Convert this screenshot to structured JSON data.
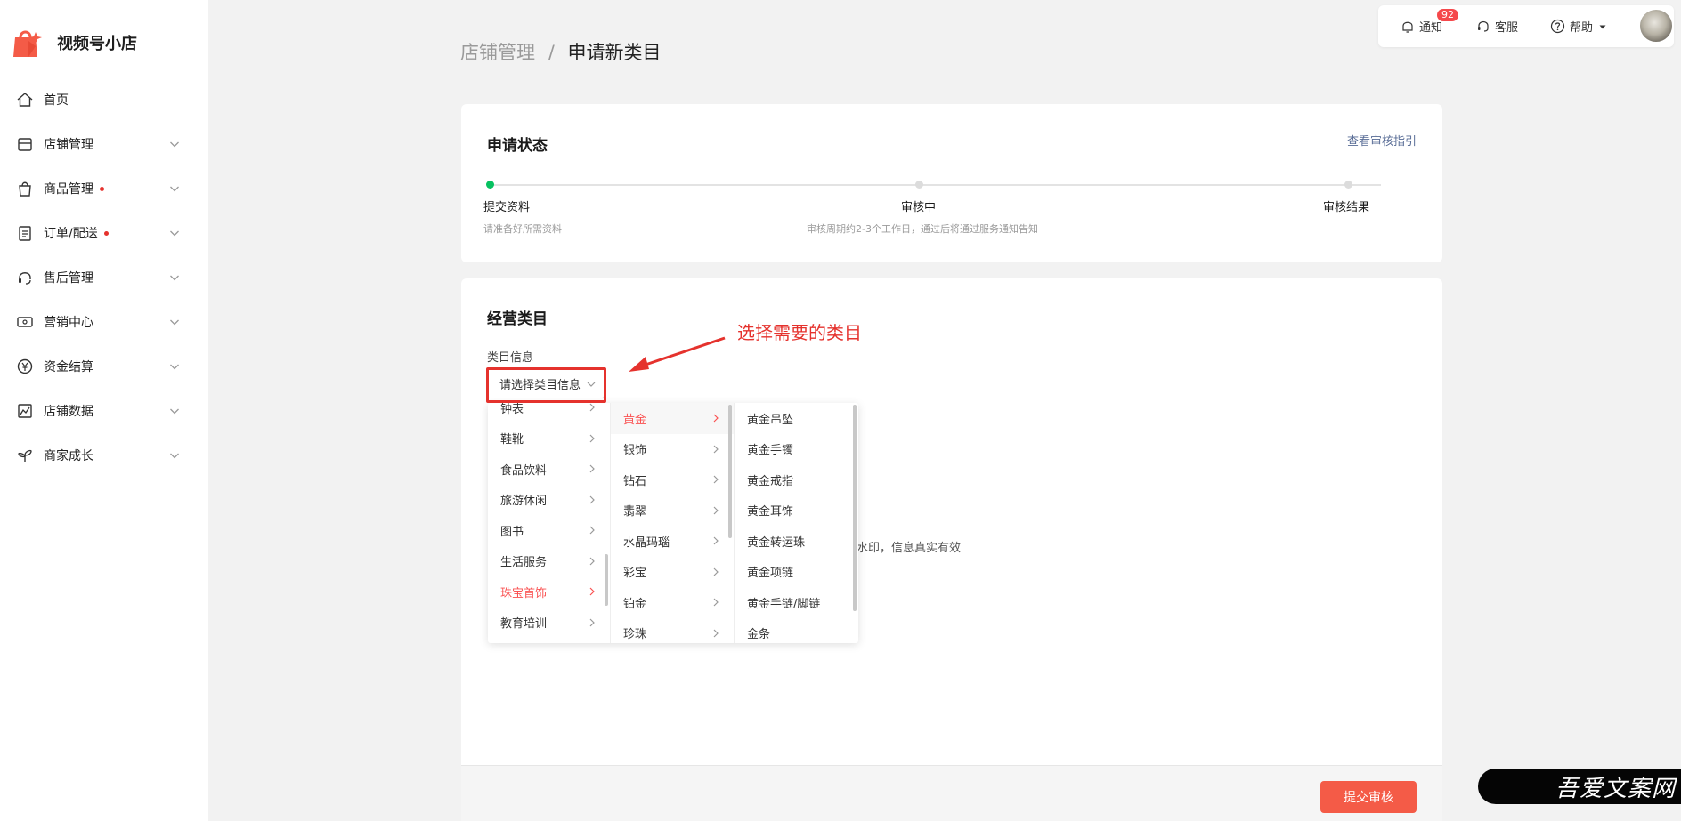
{
  "brand": {
    "name": "视频号小店"
  },
  "nav": [
    {
      "label": "首页",
      "icon": "home-icon",
      "dot": false,
      "chevron": false
    },
    {
      "label": "店铺管理",
      "icon": "store-icon",
      "dot": false,
      "chevron": true
    },
    {
      "label": "商品管理",
      "icon": "bag-icon",
      "dot": true,
      "chevron": true
    },
    {
      "label": "订单/配送",
      "icon": "clipboard-icon",
      "dot": true,
      "chevron": true
    },
    {
      "label": "售后管理",
      "icon": "headset-icon",
      "dot": false,
      "chevron": true
    },
    {
      "label": "营销中心",
      "icon": "ticket-icon",
      "dot": false,
      "chevron": true
    },
    {
      "label": "资金结算",
      "icon": "yen-icon",
      "dot": false,
      "chevron": true
    },
    {
      "label": "店铺数据",
      "icon": "chart-icon",
      "dot": false,
      "chevron": true
    },
    {
      "label": "商家成长",
      "icon": "sprout-icon",
      "dot": false,
      "chevron": true
    }
  ],
  "topbar": {
    "notify_label": "通知",
    "notify_count": "92",
    "service_label": "客服",
    "help_label": "帮助"
  },
  "breadcrumb": {
    "parent": "店铺管理",
    "separator": "/",
    "current": "申请新类目"
  },
  "status_card": {
    "title": "申请状态",
    "guide_link": "查看审核指引",
    "steps": [
      {
        "label": "提交资料",
        "desc": "请准备好所需资料",
        "active": true
      },
      {
        "label": "审核中",
        "desc": "审核周期约2-3个工作日，通过后将通过服务通知告知",
        "active": false
      },
      {
        "label": "审核结果",
        "desc": "",
        "active": false
      }
    ]
  },
  "category_card": {
    "title": "经营类目",
    "field_label": "类目信息",
    "select_placeholder": "请选择类目信息",
    "hint_partial": "水印，信息真实有效"
  },
  "annotation": {
    "text": "选择需要的类目"
  },
  "cascader": {
    "level1": [
      {
        "label": "钟表",
        "active": false
      },
      {
        "label": "鞋靴",
        "active": false
      },
      {
        "label": "食品饮料",
        "active": false
      },
      {
        "label": "旅游休闲",
        "active": false
      },
      {
        "label": "图书",
        "active": false
      },
      {
        "label": "生活服务",
        "active": false
      },
      {
        "label": "珠宝首饰",
        "active": true
      },
      {
        "label": "教育培训",
        "active": false
      }
    ],
    "level2": [
      {
        "label": "黄金",
        "active": true
      },
      {
        "label": "银饰",
        "active": false
      },
      {
        "label": "钻石",
        "active": false
      },
      {
        "label": "翡翠",
        "active": false
      },
      {
        "label": "水晶玛瑙",
        "active": false
      },
      {
        "label": "彩宝",
        "active": false
      },
      {
        "label": "铂金",
        "active": false
      },
      {
        "label": "珍珠",
        "active": false
      }
    ],
    "level3": [
      {
        "label": "黄金吊坠"
      },
      {
        "label": "黄金手镯"
      },
      {
        "label": "黄金戒指"
      },
      {
        "label": "黄金耳饰"
      },
      {
        "label": "黄金转运珠"
      },
      {
        "label": "黄金项链"
      },
      {
        "label": "黄金手链/脚链"
      },
      {
        "label": "金条"
      }
    ]
  },
  "footer": {
    "submit_label": "提交审核"
  },
  "watermark": {
    "text": "吾爱文案网"
  },
  "colors": {
    "accent": "#f45b47",
    "active_step": "#07c160",
    "link": "#576b95",
    "annotation": "#e5322d"
  }
}
